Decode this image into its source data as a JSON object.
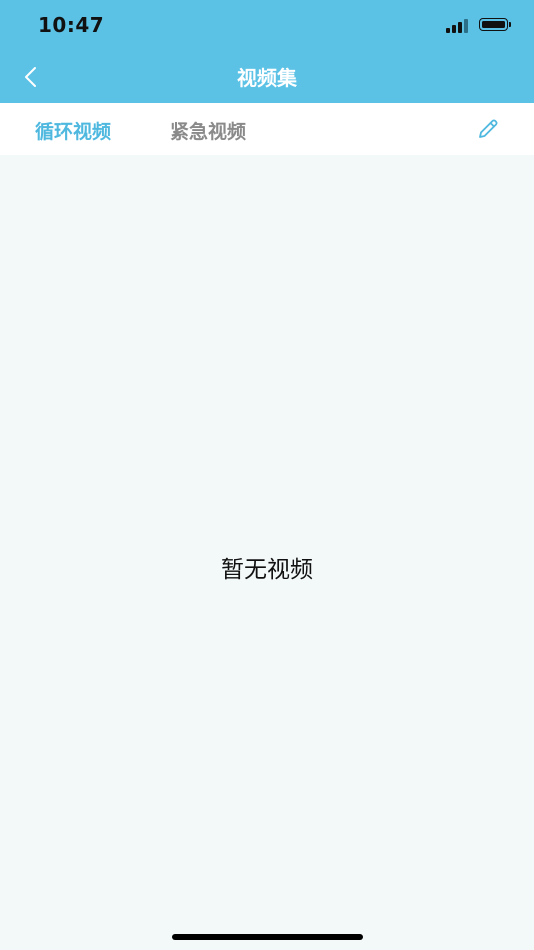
{
  "status_bar": {
    "time": "10:47"
  },
  "nav": {
    "title": "视频集",
    "back_icon": "chevron-left-icon"
  },
  "tabs": [
    {
      "label": "循环视频",
      "active": true
    },
    {
      "label": "紧急视频",
      "active": false
    }
  ],
  "toolbar": {
    "edit_icon": "pencil-icon"
  },
  "empty_state": {
    "message": "暂无视频"
  },
  "colors": {
    "header": "#5bc2e6",
    "active_tab": "#4fb8df",
    "inactive_tab": "#8a8a8a",
    "background": "#f3f8f8"
  }
}
